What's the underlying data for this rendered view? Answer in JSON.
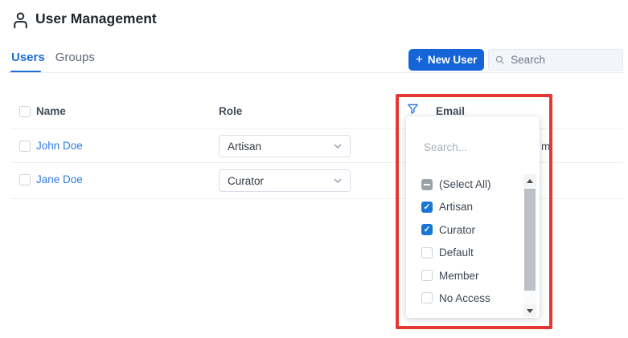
{
  "header": {
    "title": "User Management"
  },
  "tabs": [
    {
      "label": "Users",
      "active": true
    },
    {
      "label": "Groups",
      "active": false
    }
  ],
  "toolbar": {
    "plus": "+",
    "new_user_label": "New User",
    "search_placeholder": "Search"
  },
  "table": {
    "columns": [
      "Name",
      "Role",
      "Email"
    ],
    "rows": [
      {
        "name": "John Doe",
        "role": "Artisan",
        "email_visible_fragment": "m"
      },
      {
        "name": "Jane Doe",
        "role": "Curator"
      }
    ]
  },
  "filter_popup": {
    "column": "Email",
    "search_placeholder": "Search...",
    "options": [
      {
        "label": "(Select All)",
        "state": "indeterminate"
      },
      {
        "label": "Artisan",
        "state": "checked"
      },
      {
        "label": "Curator",
        "state": "checked"
      },
      {
        "label": "Default",
        "state": "unchecked"
      },
      {
        "label": "Member",
        "state": "unchecked"
      },
      {
        "label": "No Access",
        "state": "unchecked"
      }
    ]
  },
  "colors": {
    "accent_blue": "#1565d8",
    "link_blue": "#2f7ce0",
    "checkbox_blue": "#1877d4",
    "annotation_red": "#e23a33"
  }
}
